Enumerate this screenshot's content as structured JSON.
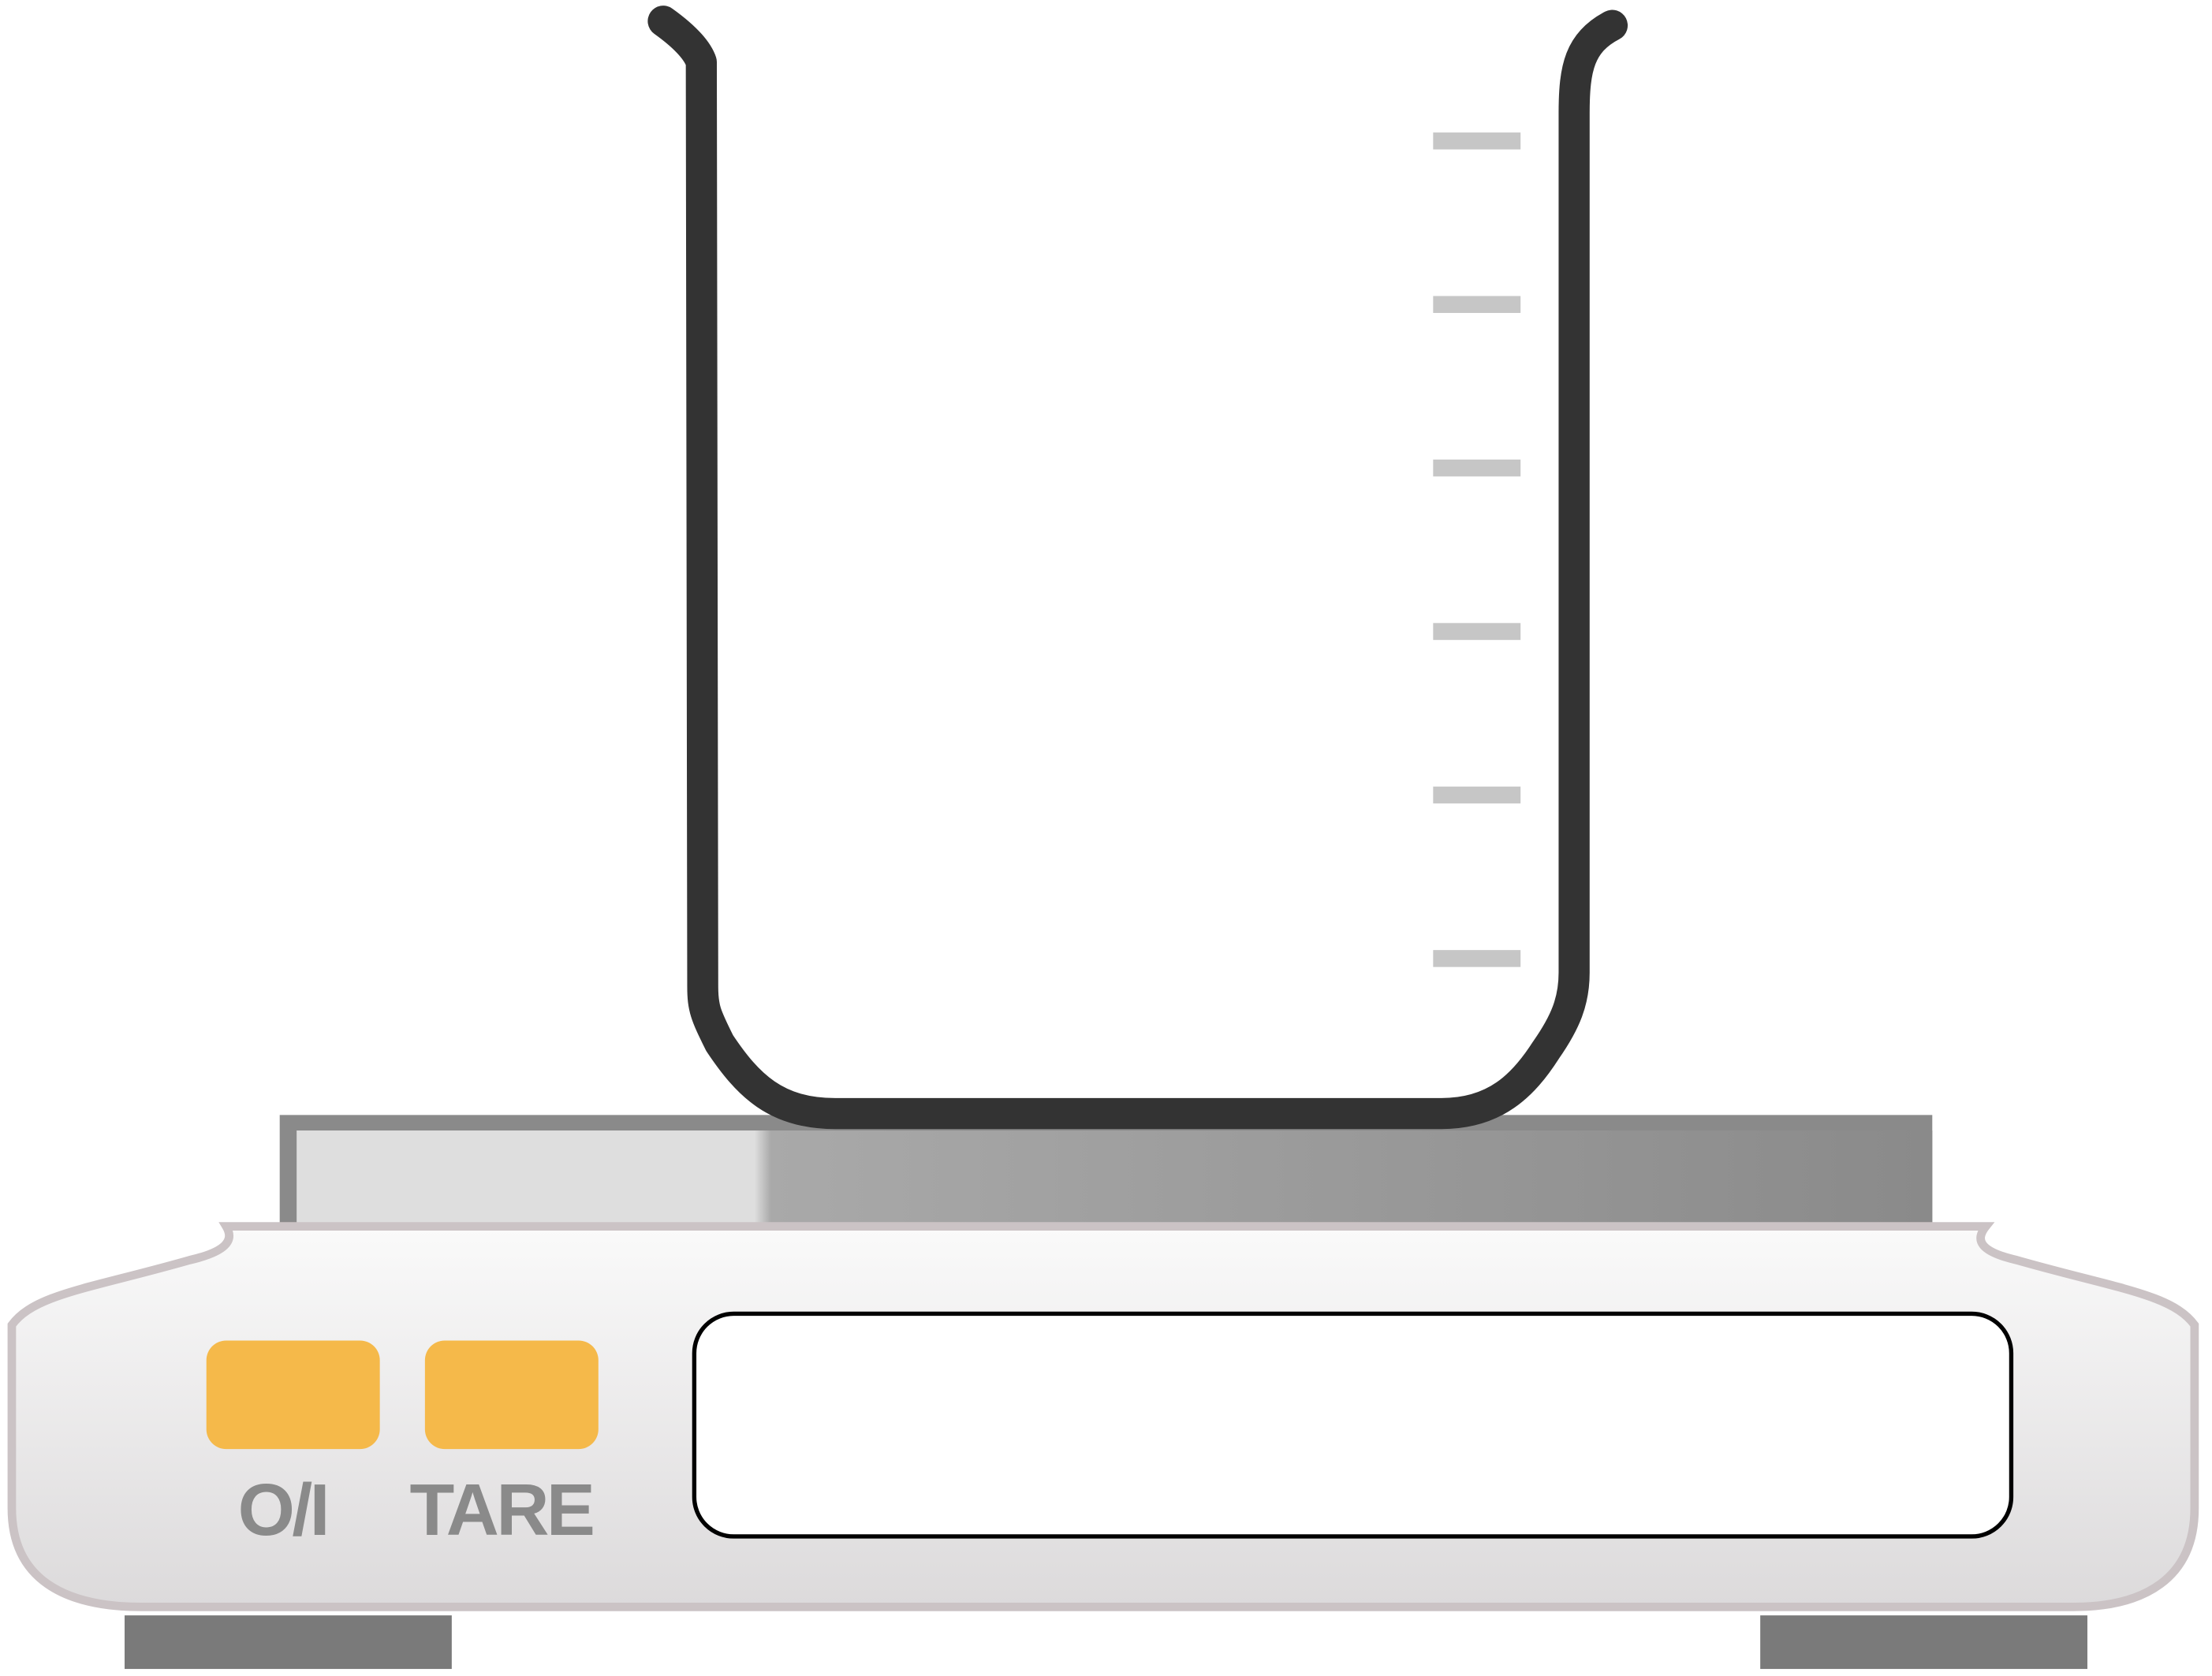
{
  "scale": {
    "buttons": [
      {
        "id": "power",
        "label": "O/I"
      },
      {
        "id": "tare",
        "label": "TARE"
      }
    ],
    "display": {
      "reading": ""
    }
  },
  "beaker": {
    "graduation_count": 6
  },
  "colors": {
    "button": "#f5b94a",
    "beaker_outline": "#333333",
    "graduation": "#c6c6c6",
    "feet": "#7a7a7a",
    "body_outline": "#cbc3c5"
  }
}
